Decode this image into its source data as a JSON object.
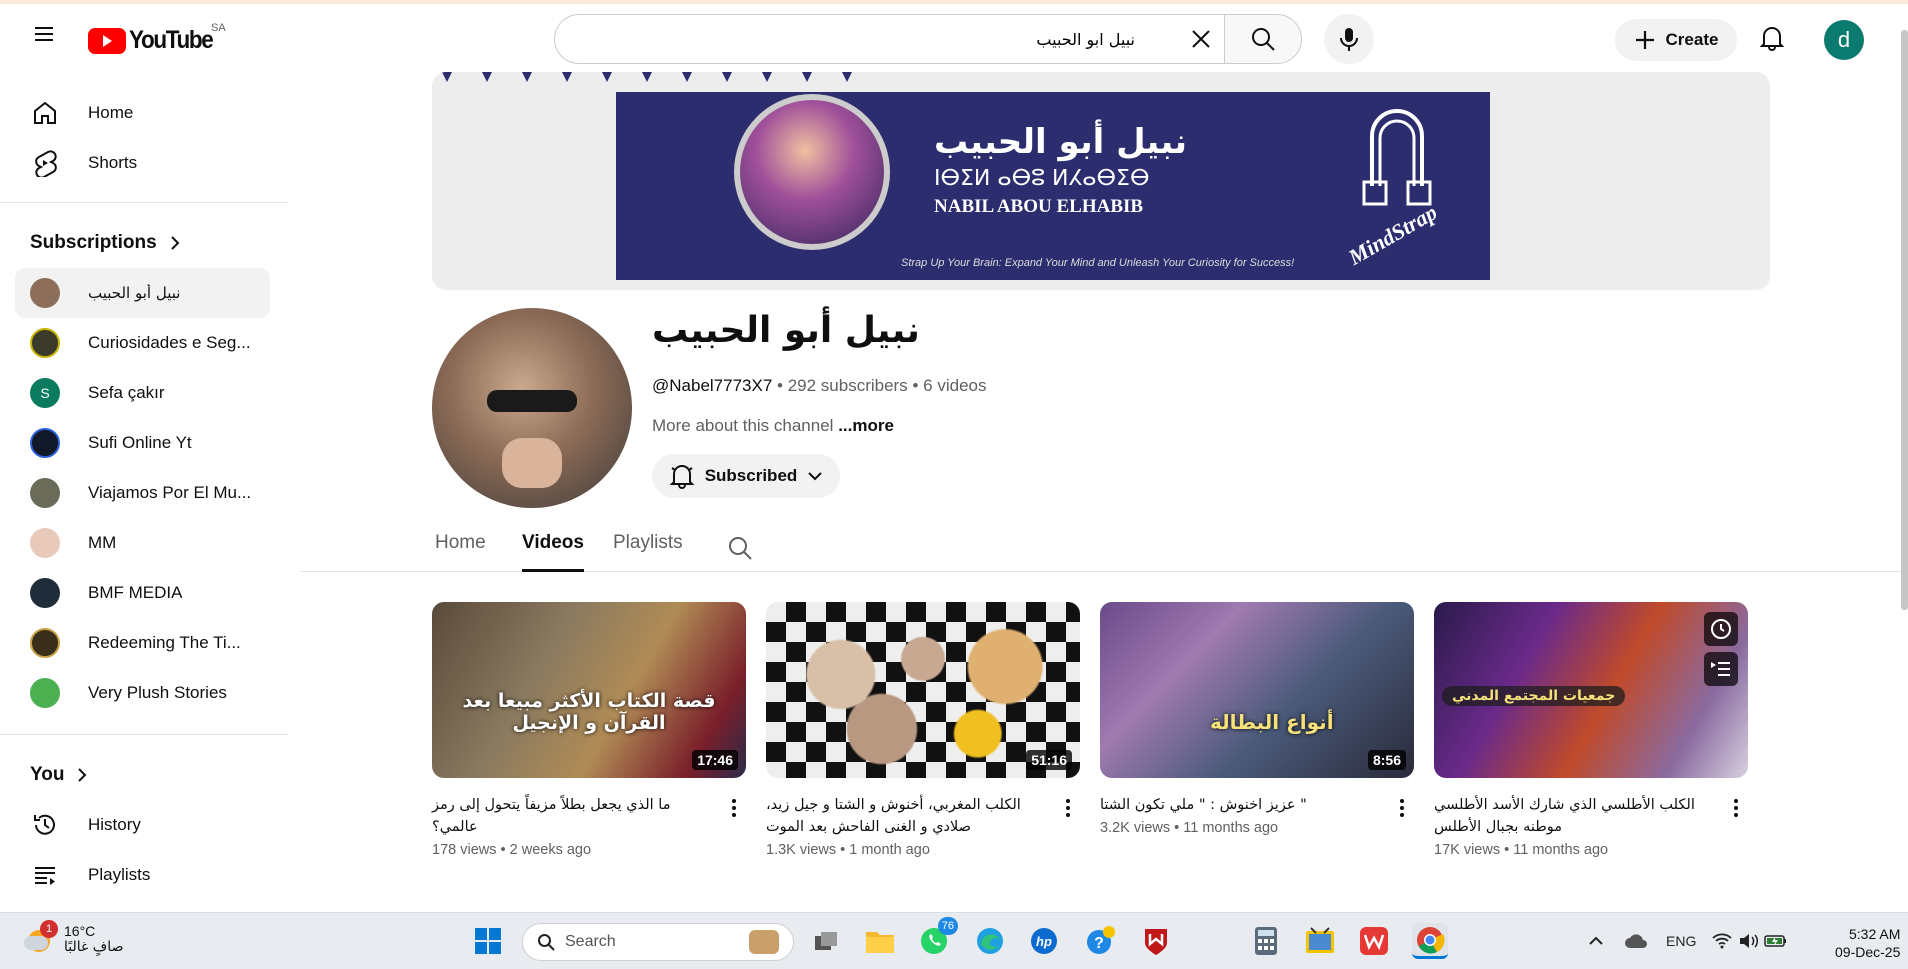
{
  "masthead": {
    "logo_text": "YouTube",
    "country_code": "SA",
    "search_value": "نبيل ابو الحبيب",
    "create_label": "Create",
    "avatar_letter": "d"
  },
  "sidebar": {
    "main": [
      {
        "label": "Home",
        "icon": "home-icon"
      },
      {
        "label": "Shorts",
        "icon": "shorts-icon"
      }
    ],
    "subscriptions_title": "Subscriptions",
    "subscriptions": [
      {
        "label": "نبيل أبو الحبيب",
        "color": "#8d6e5a",
        "initial": ""
      },
      {
        "label": "Curiosidades e Seg...",
        "color": "#3a3a2a",
        "initial": ""
      },
      {
        "label": "Sefa çakır",
        "color": "#0b7b5f",
        "initial": "S"
      },
      {
        "label": "Sufi Online Yt",
        "color": "#111827",
        "initial": ""
      },
      {
        "label": "Viajamos Por El Mu...",
        "color": "#6b6b5a",
        "initial": ""
      },
      {
        "label": "MM",
        "color": "#e9c9b9",
        "initial": ""
      },
      {
        "label": "BMF MEDIA",
        "color": "#1f2d3a",
        "initial": ""
      },
      {
        "label": "Redeeming The Ti...",
        "color": "#3a2f1a",
        "initial": ""
      },
      {
        "label": "Very Plush Stories",
        "color": "#4caf50",
        "initial": ""
      }
    ],
    "you_title": "You",
    "you_items": [
      {
        "label": "History",
        "icon": "history-icon"
      },
      {
        "label": "Playlists",
        "icon": "playlists-icon"
      }
    ]
  },
  "banner": {
    "arabic_name": "نبيل أبو الحبيب",
    "tifinagh_name": "ⵏⴱⵉⵍ ⴰⴱⵓ ⵍⵃⴰⴱⵉⴱ",
    "latin_name": "NABIL ABOU ELHABIB",
    "tagline": "Strap Up Your Brain: Expand Your Mind and Unleash Your Curiosity for Success!",
    "brand": "MindStrap"
  },
  "channel": {
    "name": "نبيل أبو الحبيب",
    "handle": "@Nabel7773X7",
    "subscribers": "292 subscribers",
    "videos_count": "6 videos",
    "about": "More about this channel",
    "more": "...more",
    "subscribed_label": "Subscribed"
  },
  "tabs": [
    "Home",
    "Videos",
    "Playlists"
  ],
  "videos": [
    {
      "title": "ما الذي يجعل بطلاً مزيفاً يتحول إلى رمز عالمي؟",
      "views": "178 views",
      "age": "2 weeks ago",
      "duration": "17:46",
      "thumb_text": "قصة الكتاب الأكثر مبيعا بعد القرآن و الإنجيل"
    },
    {
      "title": "الكلب المغربي، أخنوش و الشتا و جيل زيد، صلادي و الغنى الفاحش بعد الموت",
      "views": "1.3K views",
      "age": "1 month ago",
      "duration": "51:16",
      "thumb_text": ""
    },
    {
      "title": "\" عزيز اخنوش : \" ملي تكون الشتا",
      "views": "3.2K views",
      "age": "11 months ago",
      "duration": "8:56",
      "thumb_text": "أنواع البطالة"
    },
    {
      "title": "الكلب الأطلسي الذي شارك الأسد الأطلسي موطنه بجبال الأطلس",
      "views": "17K views",
      "age": "11 months ago",
      "duration": "",
      "thumb_text": "جمعيات المجتمع المدني"
    }
  ],
  "taskbar": {
    "temperature": "16°C",
    "weather_text": "صافٍ غالبًا",
    "weather_badge": "1",
    "search_placeholder": "Search",
    "whatsapp_badge": "76",
    "language": "ENG",
    "time": "5:32 AM",
    "date": "09-Dec-25"
  }
}
